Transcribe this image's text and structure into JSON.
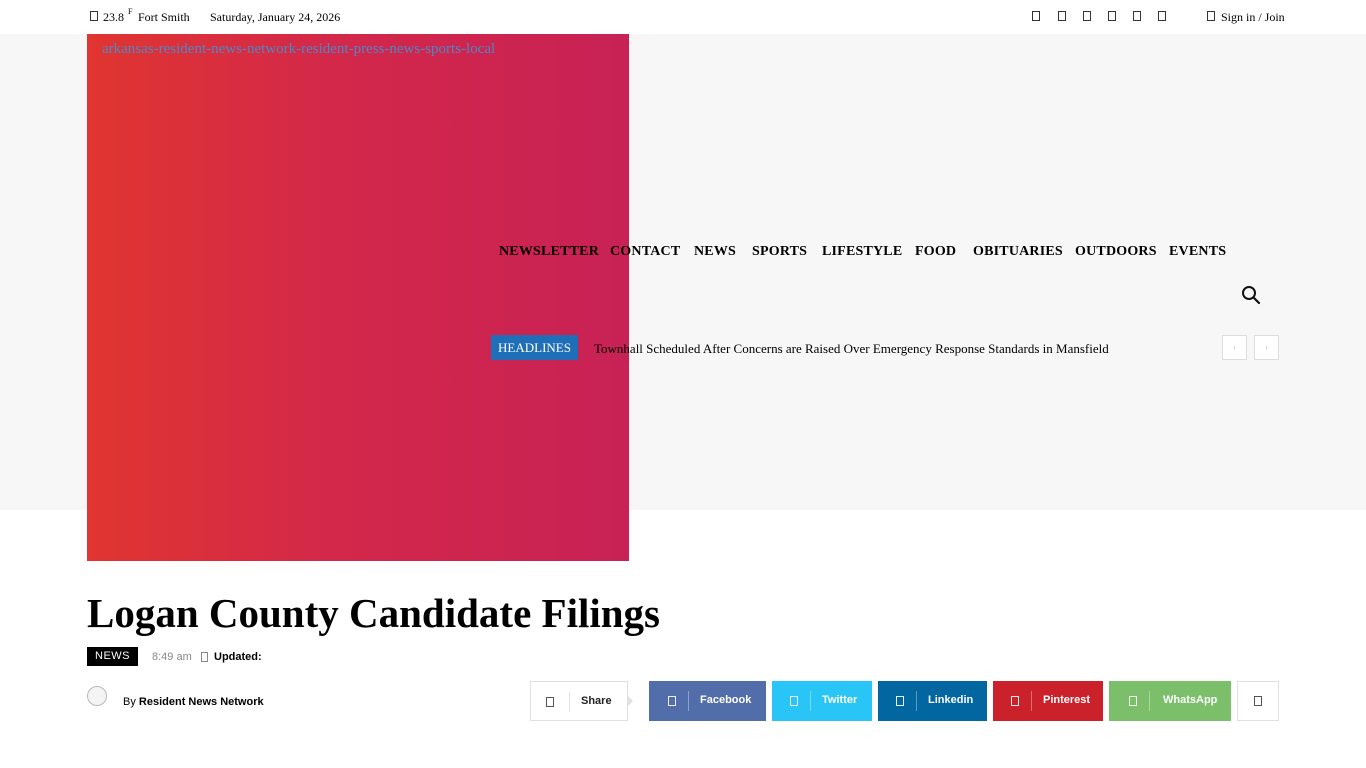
{
  "topbar": {
    "temperature": "23.8",
    "temp_unit": "F",
    "location": "Fort Smith",
    "date": "Saturday, January 24, 2026",
    "sign_in": "Sign in / Join",
    "social_icons": [
      "facebook-icon",
      "instagram-icon",
      "linkedin-icon",
      "pinterest-icon",
      "twitter-icon",
      "youtube-icon"
    ]
  },
  "logo": {
    "alt_text": "arkansas-resident-news-network-resident-press-news-sports-local"
  },
  "nav": {
    "items": [
      "NEWSLETTER",
      "CONTACT",
      "NEWS",
      "SPORTS",
      "LIFESTYLE",
      "FOOD",
      "OBITUARIES",
      "OUTDOORS",
      "EVENTS"
    ]
  },
  "ticker": {
    "badge": "HEADLINES",
    "headline": "Townhall Scheduled After Concerns are Raised Over Emergency Response Standards in Mansfield",
    "prev": "‹",
    "next": "›"
  },
  "article": {
    "title": "Logan County Candidate Filings",
    "category": "NEWS",
    "time": "8:49 am",
    "updated_label": "Updated:",
    "by": "By",
    "author": "Resident News Network"
  },
  "share": {
    "label": "Share",
    "buttons": [
      {
        "label": "Facebook",
        "color": "#516eab",
        "icon": "facebook-icon"
      },
      {
        "label": "Twitter",
        "color": "#29c5f6",
        "icon": "twitter-icon"
      },
      {
        "label": "Linkedin",
        "color": "#0266a0",
        "icon": "linkedin-icon"
      },
      {
        "label": "Pinterest",
        "color": "#ca212a",
        "icon": "pinterest-icon"
      },
      {
        "label": "WhatsApp",
        "color": "#7bbf6a",
        "icon": "whatsapp-icon"
      }
    ]
  },
  "colors": {
    "logo_gradient_start": "#e03530",
    "logo_gradient_end": "#c82155",
    "headlines_badge": "#1e6fb8",
    "header_band": "#f7f7f7"
  }
}
